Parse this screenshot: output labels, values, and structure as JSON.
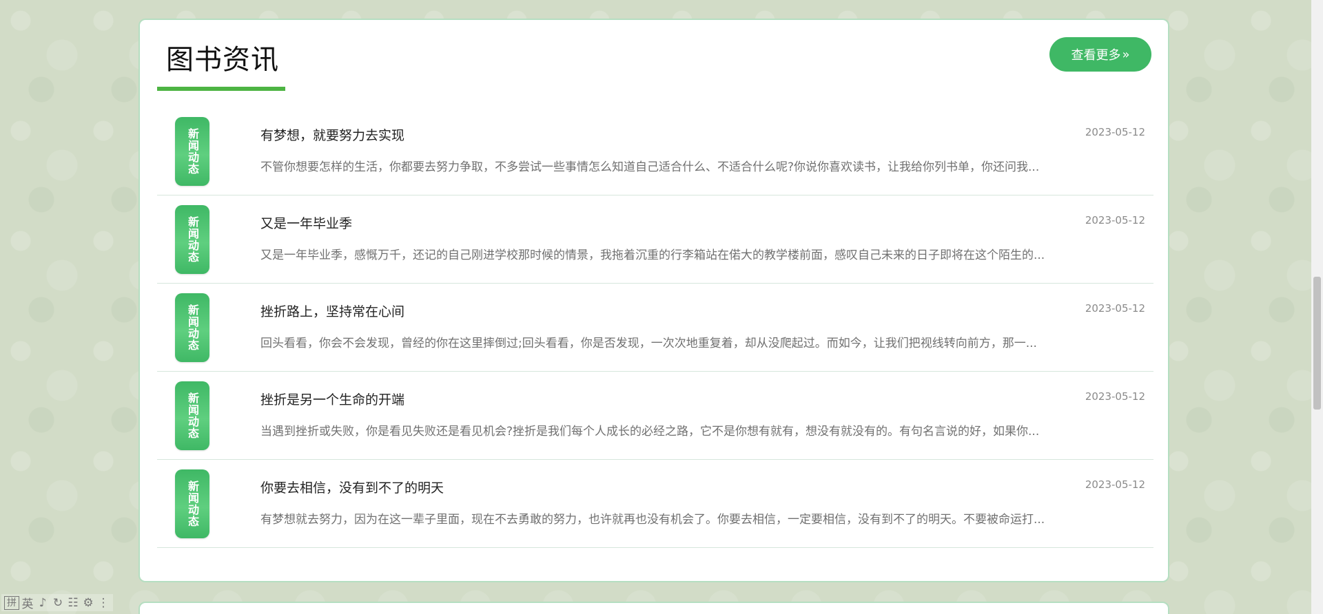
{
  "section": {
    "title": "图书资讯",
    "more_label": "查看更多",
    "more_icon": "»"
  },
  "news": [
    {
      "badge": "新闻动态",
      "title": "有梦想，就要努力去实现",
      "date": "2023-05-12",
      "summary": "不管你想要怎样的生活，你都要去努力争取，不多尝试一些事情怎么知道自己适合什么、不适合什么呢?你说你喜欢读书，让我给你列书单，你还问我..."
    },
    {
      "badge": "新闻动态",
      "title": "又是一年毕业季",
      "date": "2023-05-12",
      "summary": "又是一年毕业季，感慨万千，还记的自己刚进学校那时候的情景，我拖着沉重的行李箱站在偌大的教学楼前面，感叹自己未来的日子即将在这个陌生的..."
    },
    {
      "badge": "新闻动态",
      "title": "挫折路上，坚持常在心间",
      "date": "2023-05-12",
      "summary": "回头看看，你会不会发现，曾经的你在这里摔倒过;回头看看，你是否发现，一次次地重复着，却从没爬起过。而如今，让我们把视线转向前方，那一..."
    },
    {
      "badge": "新闻动态",
      "title": "挫折是另一个生命的开端",
      "date": "2023-05-12",
      "summary": "当遇到挫折或失败，你是看见失败还是看见机会?挫折是我们每个人成长的必经之路，它不是你想有就有，想没有就没有的。有句名言说的好，如果你..."
    },
    {
      "badge": "新闻动态",
      "title": "你要去相信，没有到不了的明天",
      "date": "2023-05-12",
      "summary": "有梦想就去努力，因为在这一辈子里面，现在不去勇敢的努力，也许就再也没有机会了。你要去相信，一定要相信，没有到不了的明天。不要被命运打..."
    }
  ],
  "ime_toolbar": {
    "mode": "拼",
    "items": [
      "英",
      "♪",
      "↻",
      "☷",
      "⚙",
      "⋮"
    ]
  }
}
